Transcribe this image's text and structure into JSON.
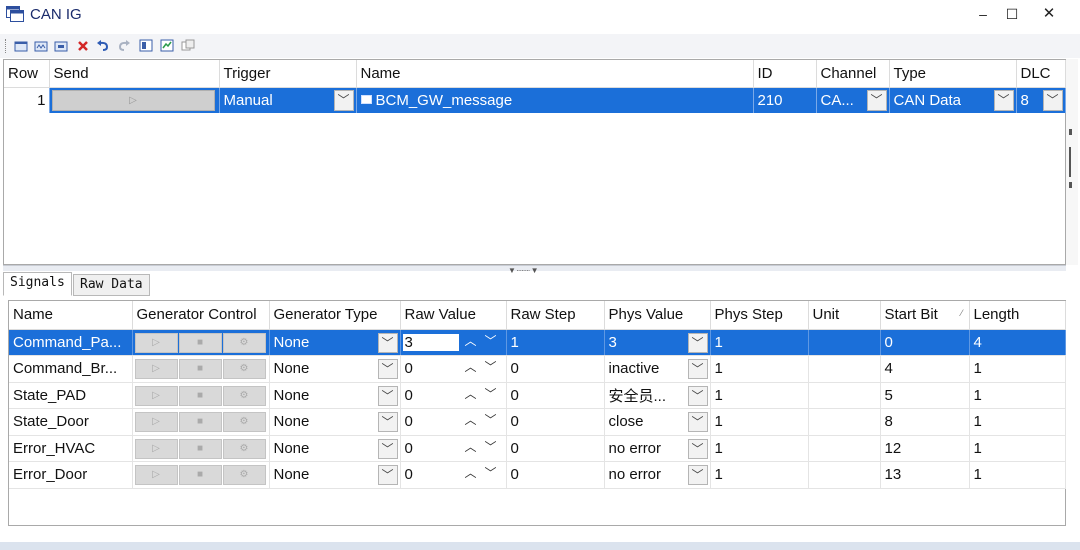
{
  "window": {
    "title": "CAN IG",
    "controls": {
      "minimize": "–",
      "maximize": "☐",
      "close": "✕"
    }
  },
  "toolbar": {
    "icons": [
      "add-message-icon",
      "add-signal-icon",
      "copy-icon",
      "delete-icon",
      "undo-icon",
      "redo-icon",
      "layout-icon",
      "chart-icon",
      "properties-icon"
    ]
  },
  "message_table": {
    "headers": [
      "Row",
      "Send",
      "Trigger",
      "Name",
      "ID",
      "Channel",
      "Type",
      "DLC"
    ],
    "rows": [
      {
        "row": "1",
        "send": "▷",
        "trigger": "Manual",
        "name": "BCM_GW_message",
        "id": "210",
        "channel": "CA...",
        "type": "CAN Data",
        "dlc": "8"
      }
    ]
  },
  "tabs": [
    "Signals",
    "Raw Data"
  ],
  "signals_table": {
    "headers": [
      "Name",
      "Generator Control",
      "Generator Type",
      "Raw Value",
      "Raw Step",
      "Phys Value",
      "Phys Step",
      "Unit",
      "Start Bit",
      "Length"
    ],
    "rows": [
      {
        "name": "Command_Pa...",
        "gen_type": "None",
        "raw_value": "3",
        "raw_step": "1",
        "phys_value": "3",
        "phys_step": "1",
        "unit": "",
        "start_bit": "0",
        "length": "4"
      },
      {
        "name": "Command_Br...",
        "gen_type": "None",
        "raw_value": "0",
        "raw_step": "0",
        "phys_value": "inactive",
        "phys_step": "1",
        "unit": "",
        "start_bit": "4",
        "length": "1"
      },
      {
        "name": "State_PAD",
        "gen_type": "None",
        "raw_value": "0",
        "raw_step": "0",
        "phys_value": "安全员...",
        "phys_step": "1",
        "unit": "",
        "start_bit": "5",
        "length": "1"
      },
      {
        "name": "State_Door",
        "gen_type": "None",
        "raw_value": "0",
        "raw_step": "0",
        "phys_value": "close",
        "phys_step": "1",
        "unit": "",
        "start_bit": "8",
        "length": "1"
      },
      {
        "name": "Error_HVAC",
        "gen_type": "None",
        "raw_value": "0",
        "raw_step": "0",
        "phys_value": "no error",
        "phys_step": "1",
        "unit": "",
        "start_bit": "12",
        "length": "1"
      },
      {
        "name": "Error_Door",
        "gen_type": "None",
        "raw_value": "0",
        "raw_step": "0",
        "phys_value": "no error",
        "phys_step": "1",
        "unit": "",
        "start_bit": "13",
        "length": "1"
      }
    ]
  },
  "colors": {
    "selection": "#1b6fd9",
    "title_text": "#1a2b6b",
    "delete_icon": "#d32626"
  }
}
